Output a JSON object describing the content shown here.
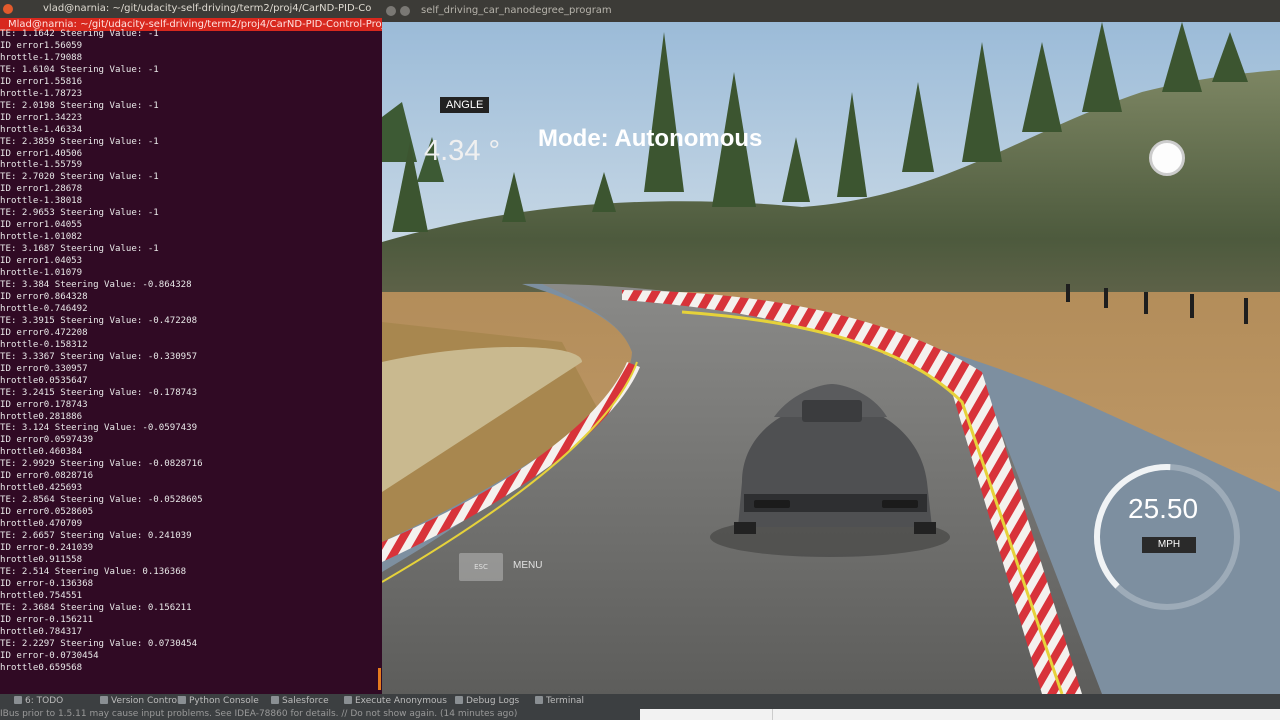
{
  "terminal": {
    "window_title": "vlad@narnia: ~/git/udacity-self-driving/term2/proj4/CarND-PID-Co",
    "tab_title": "Mlad@narnia: ~/git/udacity-self-driving/term2/proj4/CarND-PID-Control-Project",
    "lines": [
      "TE: 1.1642 Steering Value: -1",
      "ID error1.56059",
      "hrottle-1.79088",
      "TE: 1.6104 Steering Value: -1",
      "ID error1.55816",
      "hrottle-1.78723",
      "TE: 2.0198 Steering Value: -1",
      "ID error1.34223",
      "hrottle-1.46334",
      "TE: 2.3859 Steering Value: -1",
      "ID error1.40506",
      "hrottle-1.55759",
      "TE: 2.7020 Steering Value: -1",
      "ID error1.28678",
      "hrottle-1.38018",
      "TE: 2.9653 Steering Value: -1",
      "ID error1.04055",
      "hrottle-1.01082",
      "TE: 3.1687 Steering Value: -1",
      "ID error1.04053",
      "hrottle-1.01079",
      "TE: 3.384 Steering Value: -0.864328",
      "ID error0.864328",
      "hrottle-0.746492",
      "TE: 3.3915 Steering Value: -0.472208",
      "ID error0.472208",
      "hrottle-0.158312",
      "TE: 3.3367 Steering Value: -0.330957",
      "ID error0.330957",
      "hrottle0.0535647",
      "TE: 3.2415 Steering Value: -0.178743",
      "ID error0.178743",
      "hrottle0.281886",
      "TE: 3.124 Steering Value: -0.0597439",
      "ID error0.0597439",
      "hrottle0.460384",
      "TE: 2.9929 Steering Value: -0.0828716",
      "ID error0.0828716",
      "hrottle0.425693",
      "TE: 2.8564 Steering Value: -0.0528605",
      "ID error0.0528605",
      "hrottle0.470709",
      "TE: 2.6657 Steering Value: 0.241039",
      "ID error-0.241039",
      "hrottle0.911558",
      "TE: 2.514 Steering Value: 0.136368",
      "ID error-0.136368",
      "hrottle0.754551",
      "TE: 2.3684 Steering Value: 0.156211",
      "ID error-0.156211",
      "hrottle0.784317",
      "TE: 2.2297 Steering Value: 0.0730454",
      "ID error-0.0730454",
      "hrottle0.659568"
    ]
  },
  "simulator": {
    "window_title": "self_driving_car_nanodegree_program",
    "angle_label": "ANGLE",
    "angle_value": "4.34 °",
    "mode": "Mode: Autonomous",
    "speed_value": "25.50",
    "speed_unit": "MPH",
    "speed_fraction": 0.51,
    "menu_esc": "ESC",
    "menu_label": "MENU"
  },
  "ide_bar": {
    "items": [
      {
        "label": "6: TODO",
        "icon": "todo-icon"
      },
      {
        "label": "Version Control",
        "icon": "version-control-icon"
      },
      {
        "label": "Python Console",
        "icon": "python-console-icon"
      },
      {
        "label": "Salesforce",
        "icon": "salesforce-icon"
      },
      {
        "label": "Execute Anonymous",
        "icon": "execute-icon"
      },
      {
        "label": "Debug Logs",
        "icon": "debug-logs-icon"
      },
      {
        "label": "Terminal",
        "icon": "terminal-icon"
      }
    ],
    "status": "IBus prior to 1.5.11 may cause input problems. See IDEA-78860 for details. // Do not show again. (14 minutes ago)"
  }
}
